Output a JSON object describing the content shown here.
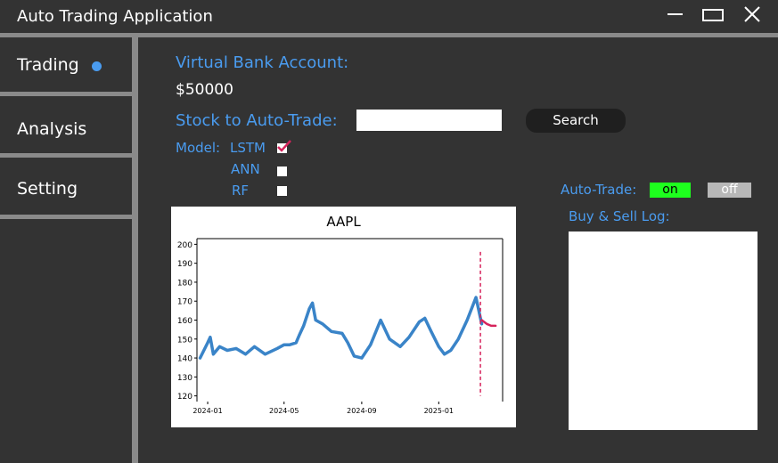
{
  "window": {
    "title": "Auto Trading Application",
    "controls": [
      "minimize",
      "maximize",
      "close"
    ]
  },
  "sidebar": {
    "items": [
      {
        "label": "Trading",
        "active": true
      },
      {
        "label": "Analysis",
        "active": false
      },
      {
        "label": "Setting",
        "active": false
      }
    ]
  },
  "main": {
    "account_label": "Virtual Bank Account:",
    "account_value": "$50000",
    "stock_label": "Stock to Auto-Trade:",
    "stock_input_value": "",
    "search_label": "Search",
    "model_label": "Model:",
    "models": [
      {
        "label": "LSTM",
        "checked": true
      },
      {
        "label": "ANN",
        "checked": false
      },
      {
        "label": "RF",
        "checked": false
      }
    ],
    "autotrade_label": "Auto-Trade:",
    "on_label": "on",
    "off_label": "off",
    "log_label": "Buy & Sell Log:"
  },
  "colors": {
    "accent": "#4a9cf0",
    "background": "#333333",
    "separator": "#8a8a8a",
    "on": "#1eff1e",
    "off": "#b8b8b8",
    "actual": "#3a84c8",
    "predicted": "#d6245c"
  },
  "chart_data": {
    "type": "line",
    "title": "AAPL",
    "xlabel": "",
    "ylabel": "",
    "x_ticks": [
      "2024-01",
      "2024-05",
      "2024-09",
      "2025-01"
    ],
    "y_ticks": [
      120,
      130,
      140,
      150,
      160,
      170,
      180,
      190,
      200
    ],
    "ylim": [
      117,
      203
    ],
    "xlim": [
      "2023-12-15",
      "2025-04-15"
    ],
    "legend": false,
    "series": [
      {
        "x": [
          "2023-12-20",
          "2024-01-01",
          "2024-01-05",
          "2024-01-10",
          "2024-01-20",
          "2024-02-01",
          "2024-02-15",
          "2024-03-01",
          "2024-03-15",
          "2024-04-01",
          "2024-04-20",
          "2024-05-01",
          "2024-05-10",
          "2024-05-20",
          "2024-05-25",
          "2024-06-01",
          "2024-06-10",
          "2024-06-15",
          "2024-06-20",
          "2024-07-01",
          "2024-07-15",
          "2024-08-01",
          "2024-08-10",
          "2024-08-20",
          "2024-09-01",
          "2024-09-15",
          "2024-10-01",
          "2024-10-15",
          "2024-11-01",
          "2024-11-15",
          "2024-12-01",
          "2024-12-10",
          "2024-12-20",
          "2025-01-01",
          "2025-01-10",
          "2025-01-20",
          "2025-02-01",
          "2025-02-15",
          "2025-03-01",
          "2025-03-10"
        ],
        "values": [
          140,
          148,
          151,
          142,
          146,
          144,
          145,
          142,
          146,
          142,
          145,
          147,
          147,
          148,
          152,
          157,
          166,
          169,
          160,
          158,
          154,
          153,
          148,
          141,
          140,
          147,
          160,
          150,
          146,
          151,
          159,
          161,
          154,
          146,
          142,
          144,
          150,
          160,
          172,
          158
        ]
      },
      {
        "x": [
          "2025-03-10",
          "2025-03-18",
          "2025-03-25",
          "2025-04-01"
        ],
        "values": [
          160,
          158,
          157,
          157
        ]
      }
    ],
    "annotations": [
      {
        "type": "vline",
        "x": "2025-03-08",
        "style": "dashed"
      }
    ]
  }
}
